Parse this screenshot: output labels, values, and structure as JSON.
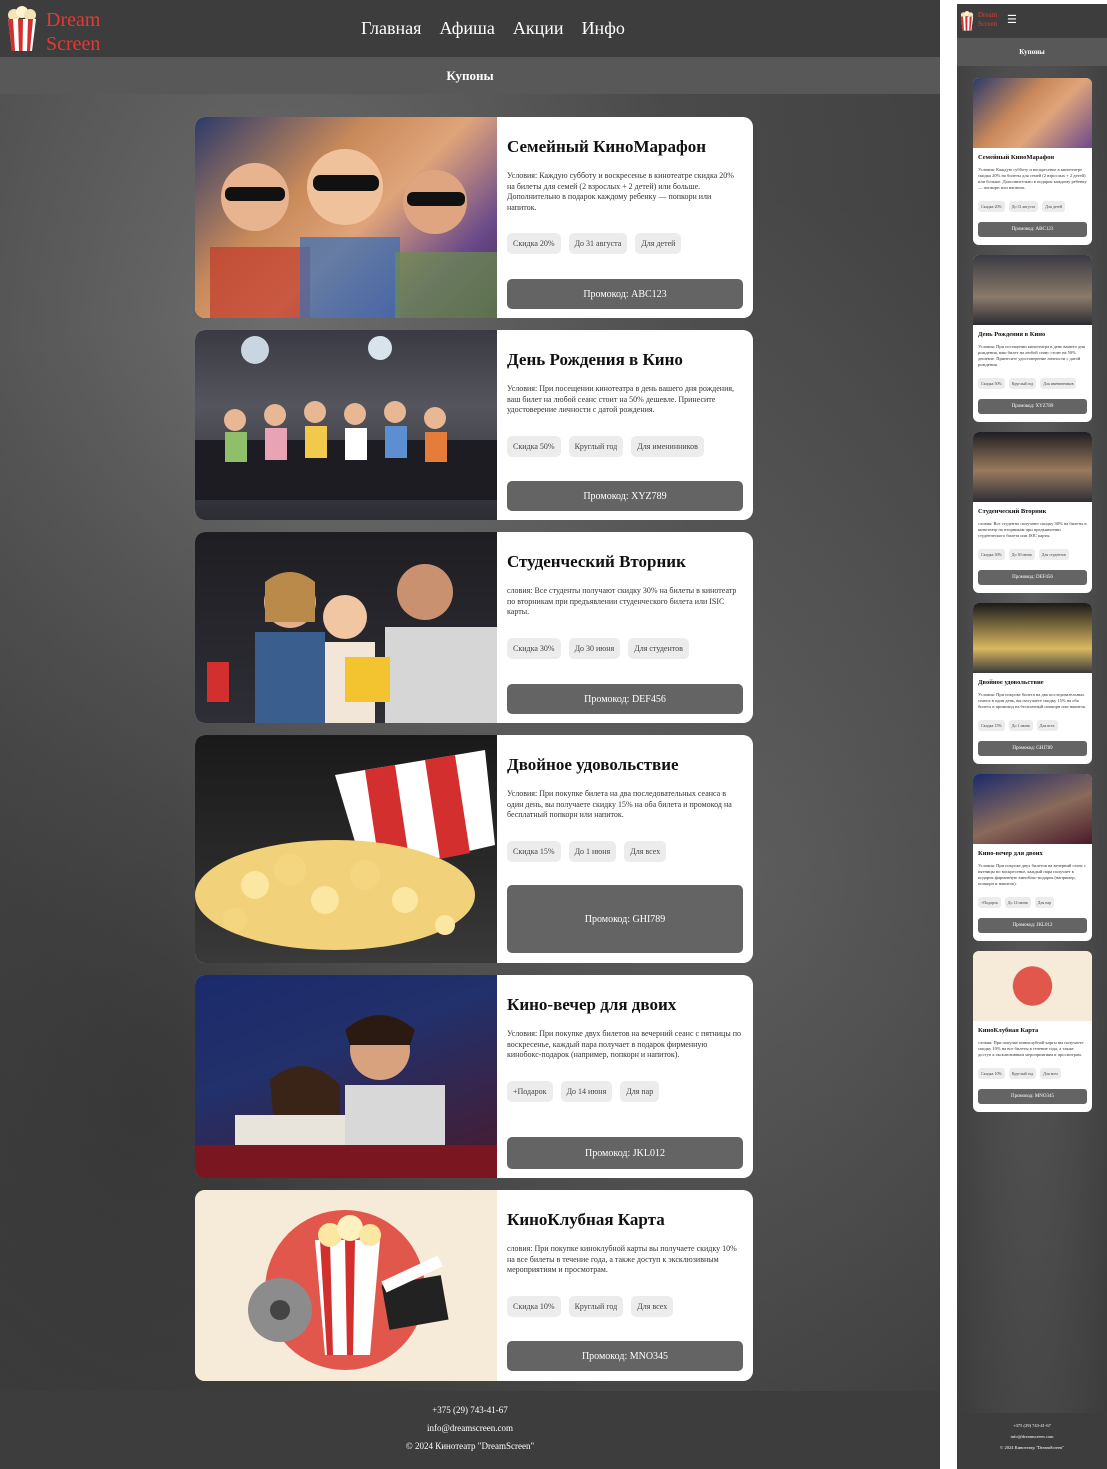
{
  "brand": {
    "line1": "Dream",
    "line2": "Screen",
    "logo_icon": "popcorn-icon",
    "accent": "#e53935"
  },
  "nav": {
    "items": [
      "Главная",
      "Афиша",
      "Акции",
      "Инфо"
    ],
    "menu_icon": "hamburger-icon"
  },
  "page": {
    "title": "Купоны"
  },
  "coupons": [
    {
      "title": "Семейный КиноМарафон",
      "text": "Условия: Каждую субботу и воскресенье в кинотеатре скидка 20% на билеты для семей (2 взрослых + 2 детей) или больше. Дополнительно в подарок каждому ребенку — попкорн или напиток.",
      "tags": [
        "Скидка 20%",
        "До 31 августа",
        "Для детей"
      ],
      "promo": "Промокод: ABC123",
      "image": "family-3d-cinema-photo"
    },
    {
      "title": "День Рождения в Кино",
      "text": "Условия: При посещении кинотеатра в день вашего дня рождения, ваш билет на любой сеанс стоит на 50% дешевле. Принесите удостоверение личности с датой рождения.",
      "tags": [
        "Скидка 50%",
        "Круглый год",
        "Для именинников"
      ],
      "promo": "Промокод: XYZ789",
      "image": "kids-birthday-cinema-photo"
    },
    {
      "title": "Студенческий Вторник",
      "text": "словия: Все студенты получают скидку 30% на билеты в кинотеатр по вторникам при предъявлении студенческого билета или ISIC карты.",
      "tags": [
        "Скидка 30%",
        "До 30 июня",
        "Для студентов"
      ],
      "promo": "Промокод: DEF456",
      "image": "students-cinema-photo"
    },
    {
      "title": "Двойное удовольствие",
      "text": "Условия: При покупке билета на два последовательных сеанса в один день, вы получаете скидку 15% на оба билета и промокод на бесплатный попкорн или напиток.",
      "tags": [
        "Скидка 15%",
        "До 1 июня",
        "Для всех"
      ],
      "promo": "Промокод: GHI789",
      "image": "spilled-popcorn-photo"
    },
    {
      "title": "Кино-вечер для двоих",
      "text": "Условия: При покупке двух билетов на вечерний сеанс с пятницы по воскресенье, каждый пара получает в подарок фирменную кинобокс-подарок (например, попкорн и напиток).",
      "tags": [
        "+Подарок",
        "До 14 июня",
        "Для пар"
      ],
      "promo": "Промокод: JKL012",
      "image": "couple-cinema-photo"
    },
    {
      "title": "КиноКлубная Карта",
      "text": "словия: При покупке киноклубной карты вы получаете скидку 10% на все билеты в течение года, а также доступ к эксклюзивным мероприятиям и просмотрам.",
      "tags": [
        "Скидка 10%",
        "Круглый год",
        "Для всех"
      ],
      "promo": "Промокод: MNO345",
      "image": "popcorn-clapperboard-illustration"
    }
  ],
  "footer": {
    "phone": "+375 (29) 743-41-67",
    "email": "info@dreamscreen.com",
    "copyright": "© 2024 Кинотеатр \"DreamScreen\""
  }
}
